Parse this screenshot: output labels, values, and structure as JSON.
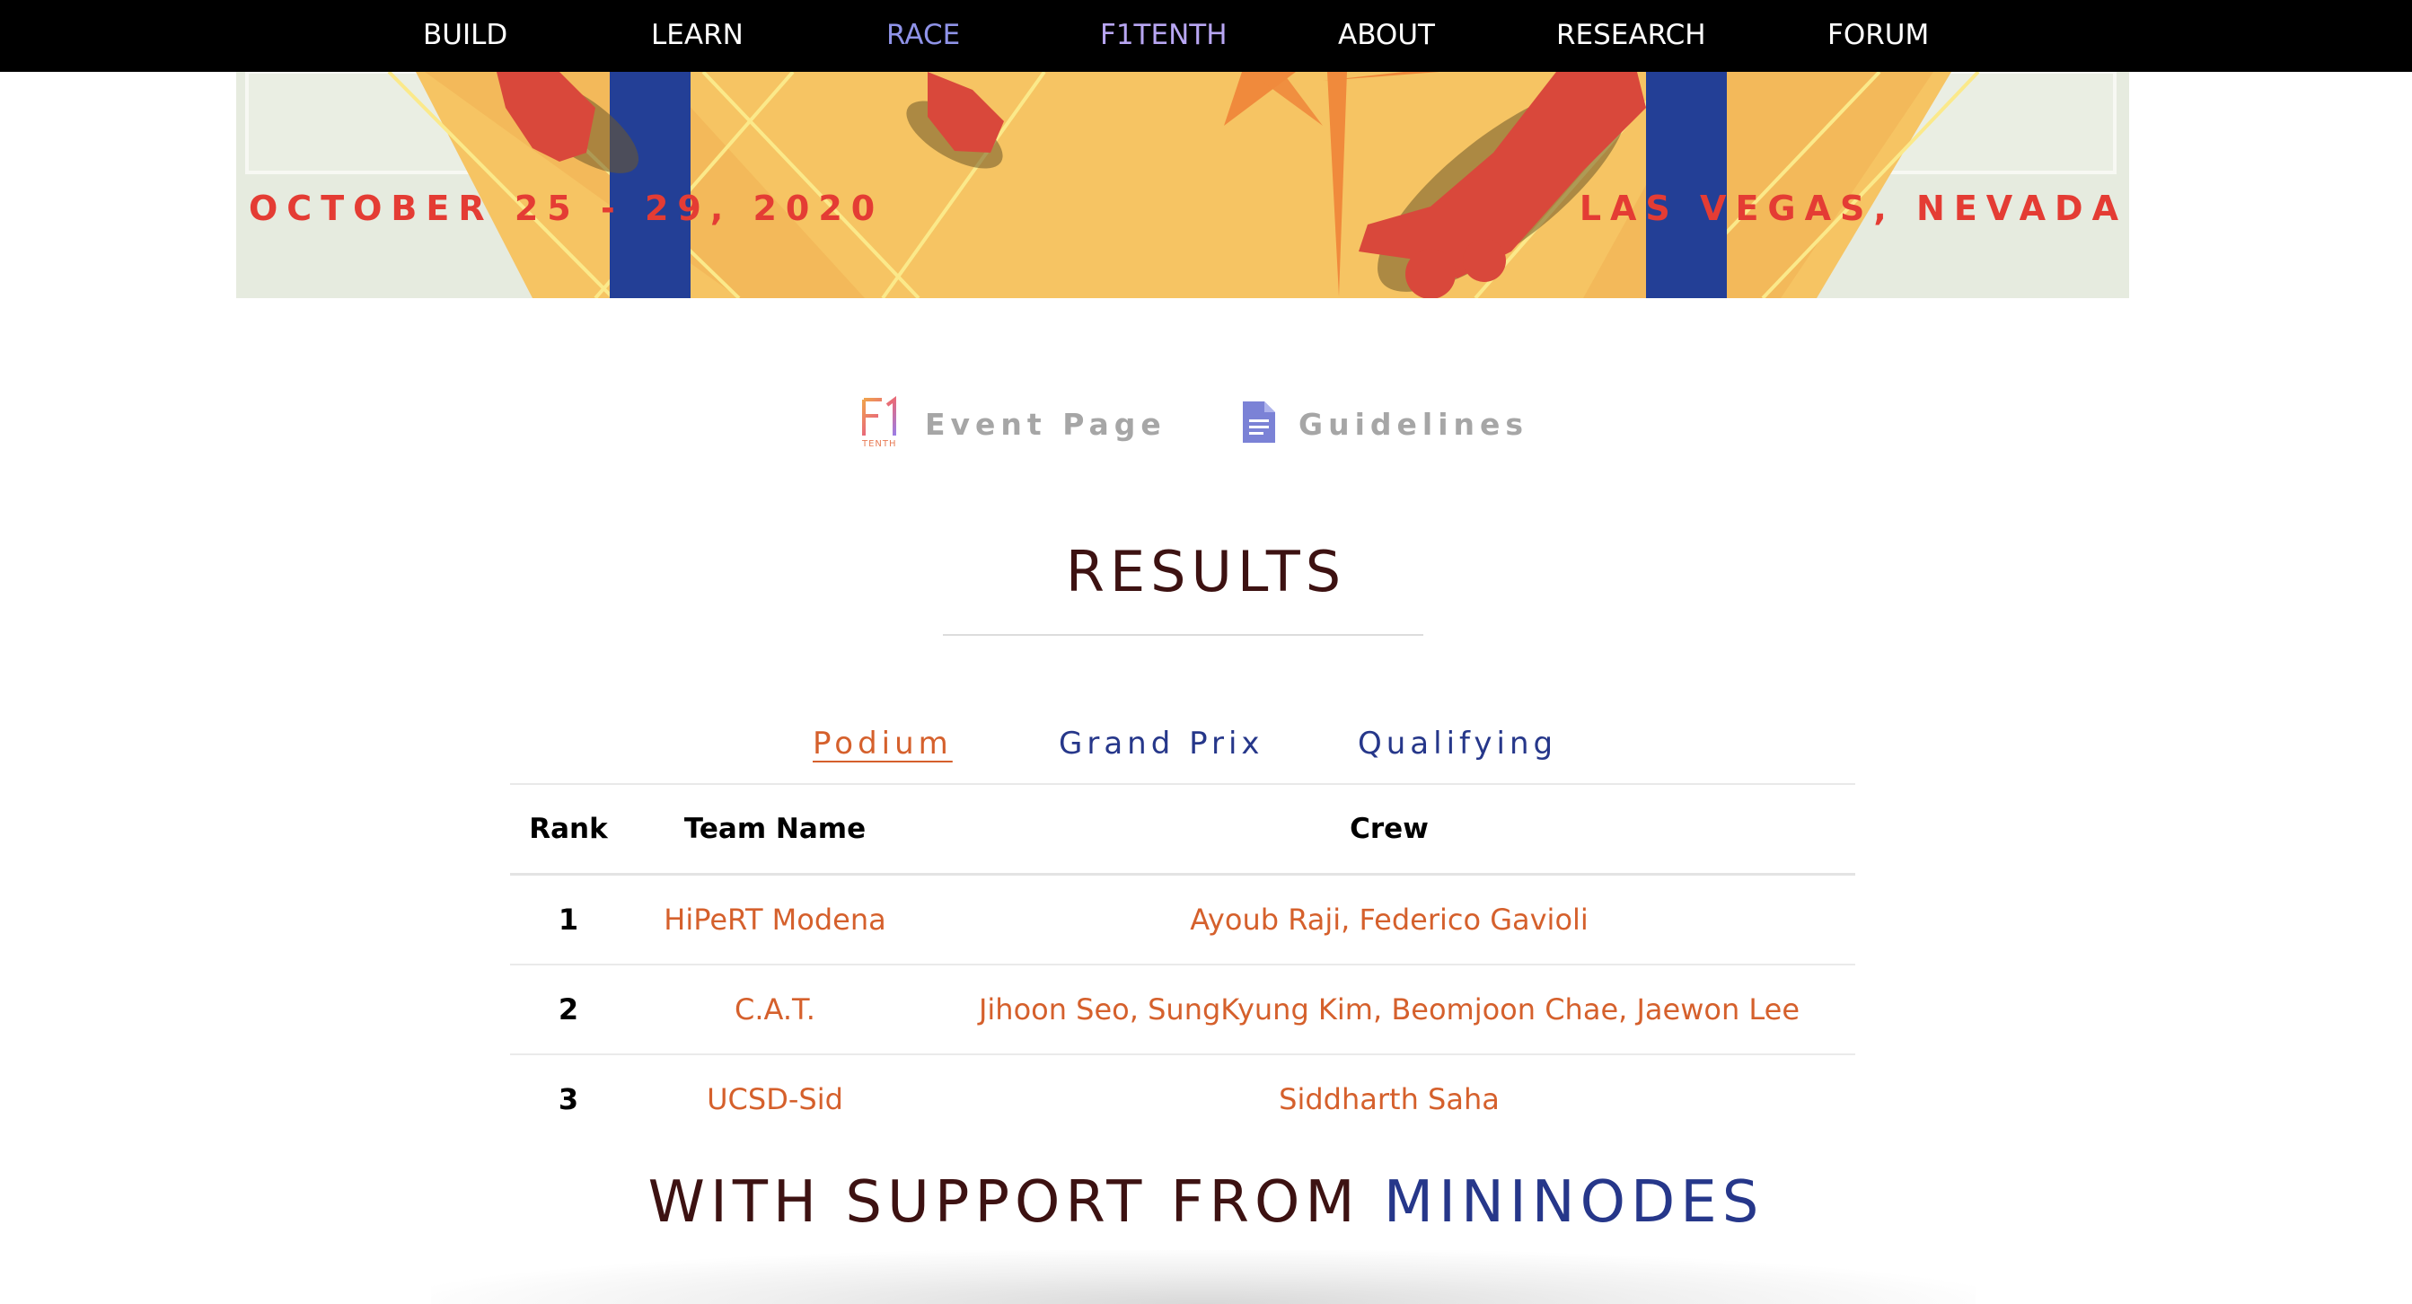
{
  "nav": {
    "items": [
      {
        "label": "BUILD"
      },
      {
        "label": "LEARN"
      },
      {
        "label": "RACE"
      },
      {
        "label": "F1TENTH"
      },
      {
        "label": "ABOUT"
      },
      {
        "label": "RESEARCH"
      },
      {
        "label": "FORUM"
      }
    ],
    "active_color": "#8f93e8"
  },
  "banner": {
    "dates": "OCTOBER 25 - 29, 2020",
    "location": "LAS VEGAS, NEVADA"
  },
  "links": {
    "event_page": {
      "label": "Event Page",
      "icon": "f1tenth-logo-icon",
      "logo_text": "TENTH"
    },
    "guidelines": {
      "label": "Guidelines",
      "icon": "document-icon"
    }
  },
  "results": {
    "title": "RESULTS",
    "tabs": [
      {
        "label": "Podium",
        "active": true
      },
      {
        "label": "Grand Prix",
        "active": false
      },
      {
        "label": "Qualifying",
        "active": false
      }
    ],
    "columns": [
      "Rank",
      "Team Name",
      "Crew"
    ],
    "rows": [
      {
        "rank": "1",
        "team": "HiPeRT Modena",
        "crew": "Ayoub Raji, Federico Gavioli"
      },
      {
        "rank": "2",
        "team": "C.A.T.",
        "crew": "Jihoon Seo, SungKyung Kim, Beomjoon Chae, Jaewon Lee"
      },
      {
        "rank": "3",
        "team": "UCSD-Sid",
        "crew": "Siddharth Saha"
      }
    ]
  },
  "support": {
    "prefix": "WITH SUPPORT FROM",
    "sponsor": "MININODES"
  },
  "colors": {
    "accent_orange": "#d5602c",
    "navy": "#26378a",
    "heading_maroon": "#3d1212"
  }
}
